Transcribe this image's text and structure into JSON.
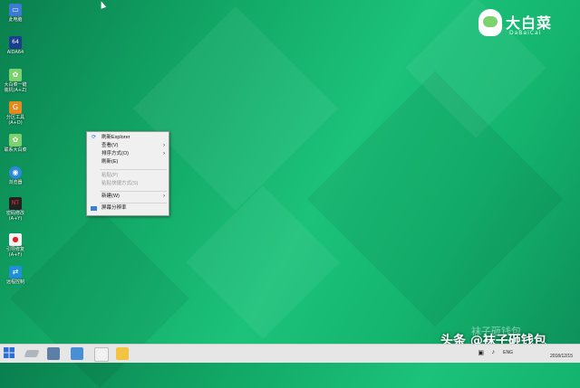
{
  "brand": {
    "name_cn": "大白菜",
    "name_en": "DaBaiCai"
  },
  "desktop_icons": [
    {
      "label": "此电脑",
      "icon": "computer-icon"
    },
    {
      "label": "AIDA64",
      "icon": "aida64-icon"
    },
    {
      "label": "大白菜一键\n装机(A+Z)",
      "icon": "dabaicai-install-icon"
    },
    {
      "label": "分区工具\n(A+D)",
      "icon": "partition-tool-icon"
    },
    {
      "label": "联系大白菜",
      "icon": "contact-dabaicai-icon"
    },
    {
      "label": "浏览器",
      "icon": "browser-icon"
    },
    {
      "label": "密码修改\n(A+Y)",
      "icon": "password-change-icon"
    },
    {
      "label": "引导修复\n(A+F)",
      "icon": "boot-repair-icon"
    },
    {
      "label": "远程控制",
      "icon": "remote-control-icon"
    }
  ],
  "context_menu": {
    "items": [
      {
        "label": "刷新Explorer",
        "icon": "refresh-explorer-icon",
        "enabled": true,
        "submenu": false
      },
      {
        "label": "查看(V)",
        "enabled": true,
        "submenu": true
      },
      {
        "label": "排序方式(O)",
        "enabled": true,
        "submenu": true
      },
      {
        "label": "刷新(E)",
        "enabled": true,
        "submenu": false
      },
      {
        "label": "粘贴(P)",
        "enabled": false,
        "submenu": false
      },
      {
        "label": "粘贴快捷方式(S)",
        "enabled": false,
        "submenu": false
      },
      {
        "label": "新建(W)",
        "enabled": true,
        "submenu": true
      },
      {
        "label": "屏幕分辨率",
        "icon": "screen-resolution-icon",
        "enabled": true,
        "submenu": false
      }
    ]
  },
  "taskbar": {
    "buttons": [
      "start-icon",
      "pen-tool-icon",
      "disk-manager-icon",
      "network-icon",
      "user-icon",
      "file-explorer-icon"
    ],
    "tray": {
      "lang": "ENG",
      "date": "2018/12/15"
    }
  },
  "watermark": {
    "top": "袜子砸钱包",
    "main": "头条 @袜子砸钱包"
  },
  "colors": {
    "desktop_green": "#12a866",
    "menu_bg": "#f0f0f0",
    "taskbar_bg": "#e6e6e6"
  }
}
